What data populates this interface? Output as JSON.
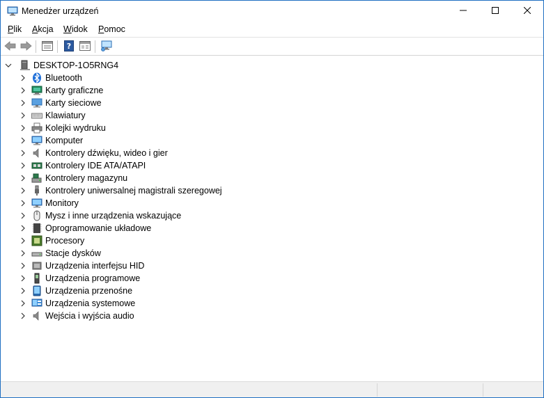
{
  "window": {
    "title": "Menedżer urządzeń"
  },
  "window_controls": {
    "minimize": "minimize-icon",
    "maximize": "maximize-icon",
    "close": "close-icon"
  },
  "menu": [
    {
      "label": "Plik"
    },
    {
      "label": "Akcja"
    },
    {
      "label": "Widok"
    },
    {
      "label": "Pomoc"
    }
  ],
  "toolbar": {
    "buttons": [
      "back-icon",
      "forward-icon",
      "properties-icon",
      "help-icon",
      "view-icon",
      "scan-hardware-icon"
    ]
  },
  "tree": {
    "root": {
      "label": "DESKTOP-1O5RNG4",
      "icon": "computer-icon",
      "expanded": true
    },
    "categories": [
      {
        "label": "Bluetooth",
        "icon": "bluetooth-icon"
      },
      {
        "label": "Karty graficzne",
        "icon": "display-adapter-icon"
      },
      {
        "label": "Karty sieciowe",
        "icon": "network-adapter-icon"
      },
      {
        "label": "Klawiatury",
        "icon": "keyboard-icon"
      },
      {
        "label": "Kolejki wydruku",
        "icon": "printer-icon"
      },
      {
        "label": "Komputer",
        "icon": "computer-icon"
      },
      {
        "label": "Kontrolery dźwięku, wideo i gier",
        "icon": "speaker-icon"
      },
      {
        "label": "Kontrolery IDE ATA/ATAPI",
        "icon": "ide-controller-icon"
      },
      {
        "label": "Kontrolery magazynu",
        "icon": "storage-controller-icon"
      },
      {
        "label": "Kontrolery uniwersalnej magistrali szeregowej",
        "icon": "usb-icon"
      },
      {
        "label": "Monitory",
        "icon": "monitor-icon"
      },
      {
        "label": "Mysz i inne urządzenia wskazujące",
        "icon": "mouse-icon"
      },
      {
        "label": "Oprogramowanie układowe",
        "icon": "firmware-icon"
      },
      {
        "label": "Procesory",
        "icon": "processor-icon"
      },
      {
        "label": "Stacje dysków",
        "icon": "disk-drive-icon"
      },
      {
        "label": "Urządzenia interfejsu HID",
        "icon": "hid-icon"
      },
      {
        "label": "Urządzenia programowe",
        "icon": "software-device-icon"
      },
      {
        "label": "Urządzenia przenośne",
        "icon": "portable-device-icon"
      },
      {
        "label": "Urządzenia systemowe",
        "icon": "system-device-icon"
      },
      {
        "label": "Wejścia i wyjścia audio",
        "icon": "audio-io-icon"
      }
    ]
  }
}
